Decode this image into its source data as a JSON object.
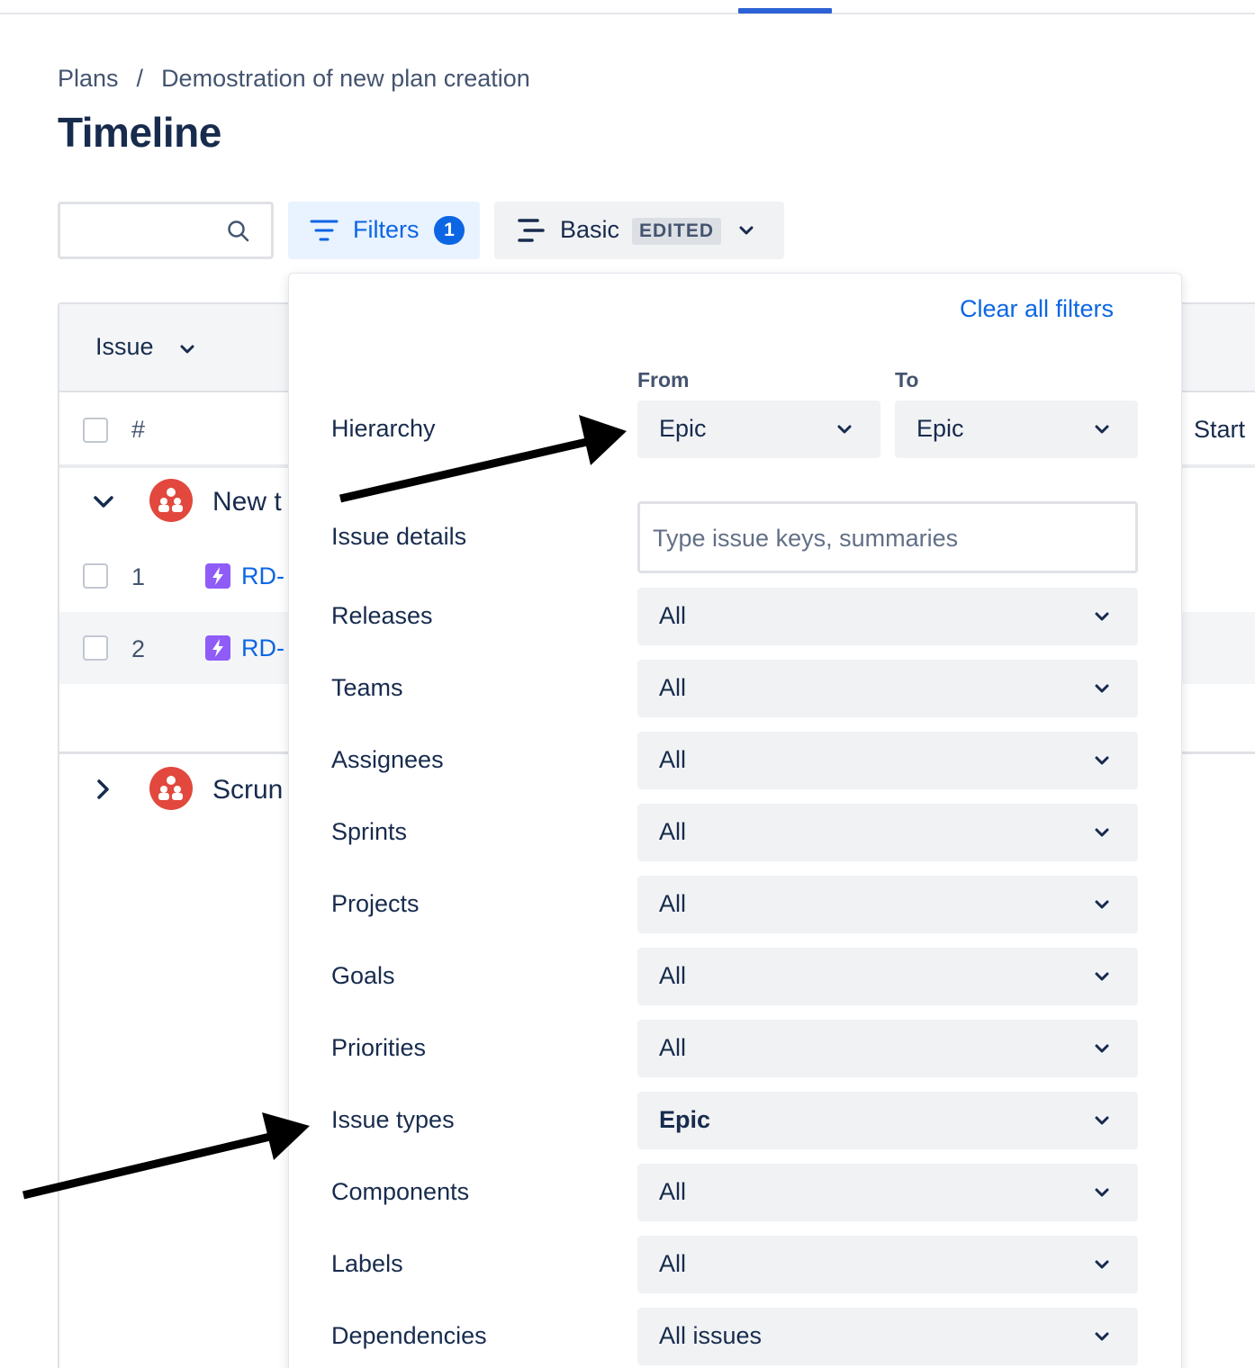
{
  "breadcrumb": {
    "root": "Plans",
    "separator": "/",
    "current": "Demostration of new plan creation"
  },
  "page": {
    "title": "Timeline"
  },
  "toolbar": {
    "search_placeholder": "",
    "filters_label": "Filters",
    "filters_count": "1",
    "view_label": "Basic",
    "view_status": "EDITED"
  },
  "table": {
    "issue_header": "Issue",
    "hash_header": "#",
    "start_header": "Start",
    "groups": [
      {
        "label": "New t",
        "expanded": true,
        "rows": [
          {
            "num": "1",
            "key": "RD-"
          },
          {
            "num": "2",
            "key": "RD-"
          }
        ]
      },
      {
        "label": "Scrun",
        "expanded": false
      }
    ]
  },
  "filters": {
    "clear_all": "Clear all filters",
    "hierarchy": {
      "label": "Hierarchy",
      "from_label": "From",
      "to_label": "To",
      "from_value": "Epic",
      "to_value": "Epic"
    },
    "issue_details": {
      "label": "Issue details",
      "placeholder": "Type issue keys, summaries"
    },
    "rows": [
      {
        "label": "Releases",
        "value": "All",
        "active": false
      },
      {
        "label": "Teams",
        "value": "All",
        "active": false
      },
      {
        "label": "Assignees",
        "value": "All",
        "active": false
      },
      {
        "label": "Sprints",
        "value": "All",
        "active": false
      },
      {
        "label": "Projects",
        "value": "All",
        "active": false
      },
      {
        "label": "Goals",
        "value": "All",
        "active": false
      },
      {
        "label": "Priorities",
        "value": "All",
        "active": false
      },
      {
        "label": "Issue types",
        "value": "Epic",
        "active": true
      },
      {
        "label": "Components",
        "value": "All",
        "active": false
      },
      {
        "label": "Labels",
        "value": "All",
        "active": false
      },
      {
        "label": "Dependencies",
        "value": "All issues",
        "active": false
      }
    ]
  },
  "colors": {
    "accent": "#0c66e4",
    "text": "#172b4d",
    "select_bg": "#f1f2f4",
    "team_avatar": "#e2483d",
    "epic_icon": "#8f5cf7"
  }
}
